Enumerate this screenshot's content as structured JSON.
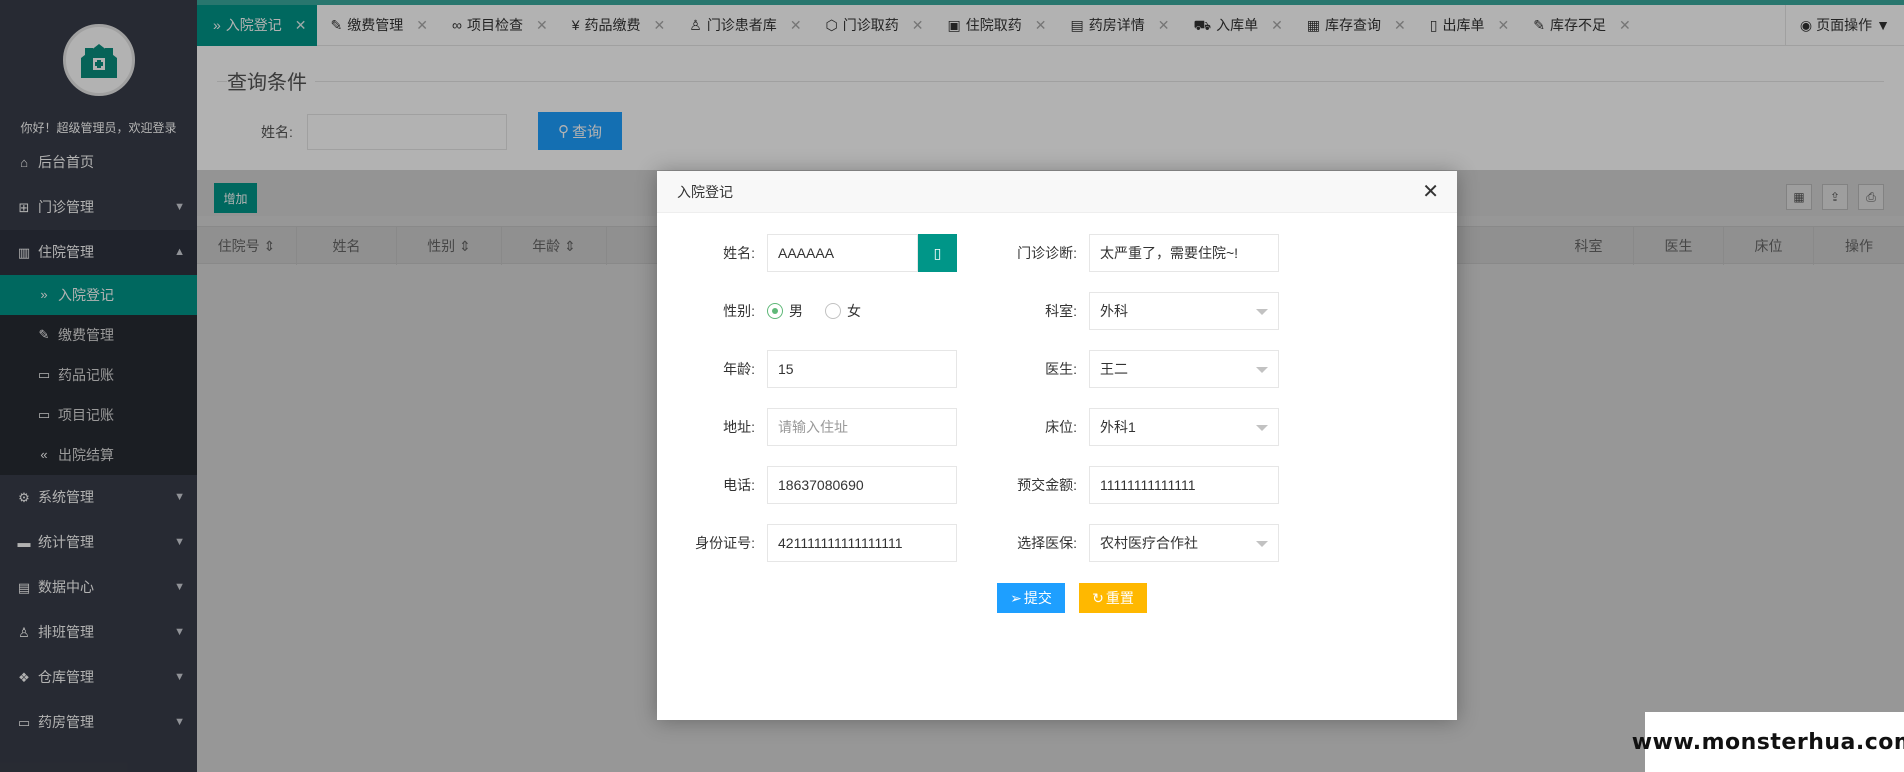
{
  "sidebar": {
    "greeting": "你好！超级管理员，欢迎登录",
    "menu": [
      {
        "label": "后台首页",
        "icon": "home-icon"
      },
      {
        "label": "门诊管理",
        "icon": "grid-icon"
      },
      {
        "label": "住院管理",
        "icon": "columns-icon"
      },
      {
        "label": "系统管理",
        "icon": "gear-icon"
      },
      {
        "label": "统计管理",
        "icon": "chat-icon"
      },
      {
        "label": "数据中心",
        "icon": "file-icon"
      },
      {
        "label": "排班管理",
        "icon": "user-icon"
      },
      {
        "label": "仓库管理",
        "icon": "cubes-icon"
      },
      {
        "label": "药房管理",
        "icon": "book-icon"
      }
    ],
    "submenu": [
      {
        "label": "入院登记",
        "icon": "double-right-icon"
      },
      {
        "label": "缴费管理",
        "icon": "edit-icon"
      },
      {
        "label": "药品记账",
        "icon": "book-icon"
      },
      {
        "label": "项目记账",
        "icon": "book-icon"
      },
      {
        "label": "出院结算",
        "icon": "double-left-icon"
      }
    ]
  },
  "tabs": [
    {
      "label": "入院登记",
      "icon": "»"
    },
    {
      "label": "缴费管理",
      "icon": "✎"
    },
    {
      "label": "项目检查",
      "icon": "∞"
    },
    {
      "label": "药品缴费",
      "icon": "¥"
    },
    {
      "label": "门诊患者库",
      "icon": "♙"
    },
    {
      "label": "门诊取药",
      "icon": "⬡"
    },
    {
      "label": "住院取药",
      "icon": "▣"
    },
    {
      "label": "药房详情",
      "icon": "▤"
    },
    {
      "label": "入库单",
      "icon": "⛟"
    },
    {
      "label": "库存查询",
      "icon": "▦"
    },
    {
      "label": "出库单",
      "icon": "▯"
    },
    {
      "label": "库存不足",
      "icon": "✎"
    }
  ],
  "page_op": "页面操作",
  "query": {
    "legend": "查询条件",
    "name_label": "姓名:",
    "search_btn": "查询"
  },
  "toolbar": {
    "add_btn": "增加"
  },
  "table": {
    "headers": [
      "住院号",
      "姓名",
      "性别",
      "年龄",
      "科室",
      "医生",
      "床位",
      "操作"
    ]
  },
  "modal": {
    "title": "入院登记",
    "fields": {
      "name_label": "姓名:",
      "name_value": "AAAAAA",
      "diagnosis_label": "门诊诊断:",
      "diagnosis_value": "太严重了，需要住院~!",
      "gender_label": "性别:",
      "gender_male": "男",
      "gender_female": "女",
      "dept_label": "科室:",
      "dept_value": "外科",
      "age_label": "年龄:",
      "age_value": "15",
      "doctor_label": "医生:",
      "doctor_value": "王二",
      "address_label": "地址:",
      "address_placeholder": "请输入住址",
      "bed_label": "床位:",
      "bed_value": "外科1",
      "phone_label": "电话:",
      "phone_value": "18637080690",
      "deposit_label": "预交金额:",
      "deposit_value": "11111111111111",
      "id_label": "身份证号:",
      "id_value": "421111111111111111",
      "insurance_label": "选择医保:",
      "insurance_value": "农村医疗合作社"
    },
    "submit_btn": "提交",
    "reset_btn": "重置"
  },
  "watermark": "www.monsterhua.com",
  "colors": {
    "primary": "#009688",
    "blue": "#1e9fff",
    "yellow": "#ffb800",
    "sidebar": "#393d49"
  }
}
